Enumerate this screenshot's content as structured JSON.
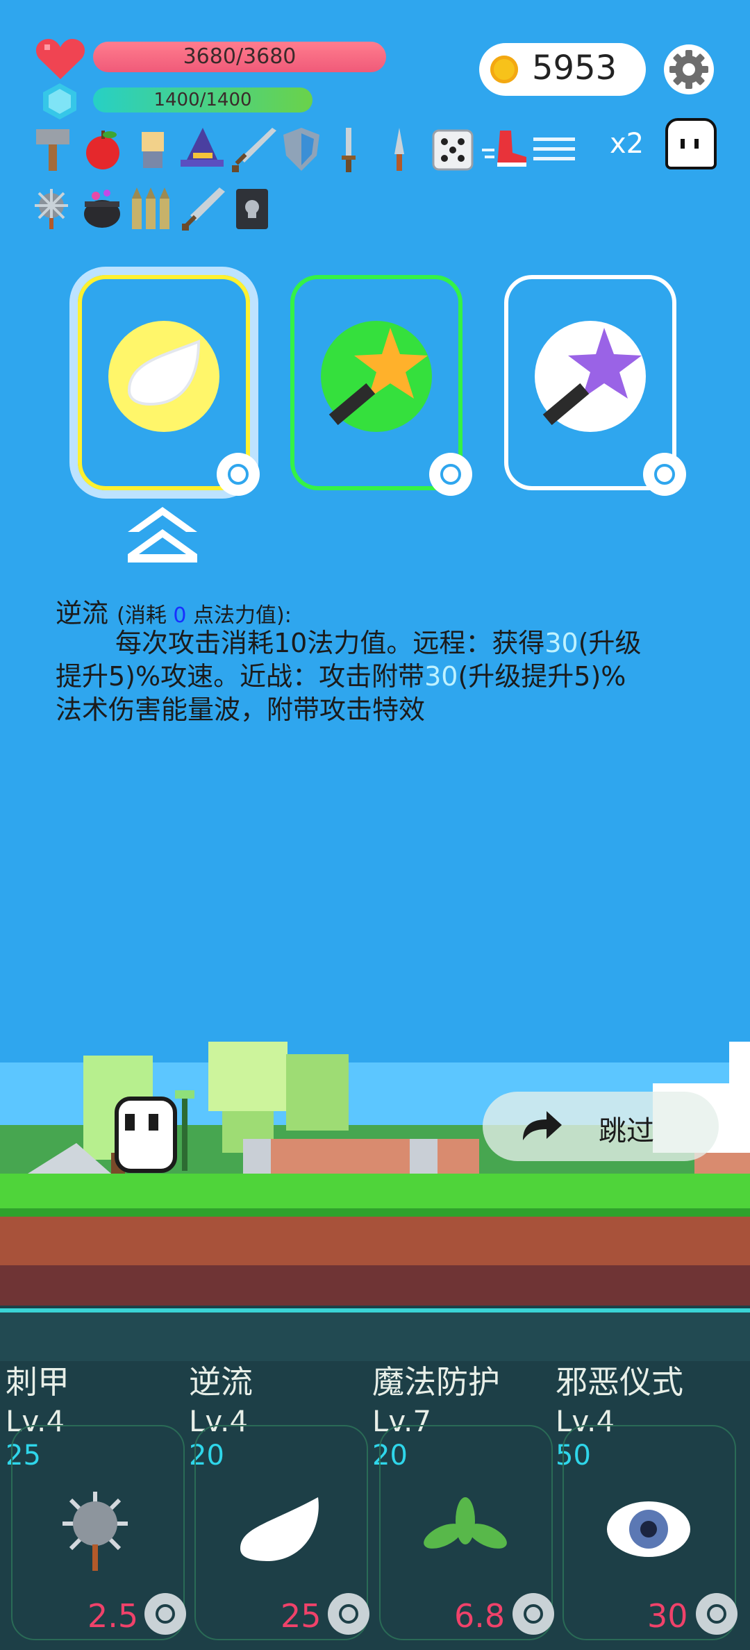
{
  "hud": {
    "hp_text": "3680/3680",
    "hp_fraction": 1.0,
    "mp_text": "1400/1400",
    "mp_fraction": 1.0,
    "coins": "5953",
    "multiplier": "x2",
    "icons": [
      "heart-icon",
      "mana-gem-icon",
      "coin-icon",
      "gear-icon",
      "ghost-icon"
    ]
  },
  "inventory": {
    "row1": [
      "hammer",
      "apple",
      "gauntlet",
      "wizard-hat",
      "sword",
      "shield",
      "dagger",
      "knife",
      "dice",
      "boot",
      "arrows"
    ],
    "row2": [
      "spiked-mace",
      "cauldron",
      "bullets",
      "broadsword",
      "skull-book"
    ]
  },
  "choices": [
    {
      "name": "wing-orb",
      "border": "#fff12f",
      "selected": true
    },
    {
      "name": "gold-star-wand",
      "border": "#35f246",
      "selected": false
    },
    {
      "name": "purple-star-wand",
      "border": "#ffffff",
      "selected": false
    }
  ],
  "description": {
    "title": "逆流",
    "cost_prefix": "(消耗 ",
    "cost_value": "0",
    "cost_suffix": " 点法力值):",
    "line1_a": "每次攻击消耗10法力值。远程：获得",
    "line1_v": "30",
    "line1_b": "(升级",
    "line2_a": "提升5)%攻速。近战：攻击附带",
    "line2_v": "30",
    "line2_b": "(升级提升5)%",
    "line3": "法术伤害能量波，附带攻击特效"
  },
  "skip_label": "跳过",
  "slots": [
    {
      "name": "刺甲",
      "level": "Lv.4",
      "cost": "25",
      "value": "2.5",
      "icon": "spiked-ball-icon"
    },
    {
      "name": "逆流",
      "level": "Lv.4",
      "cost": "20",
      "value": "25",
      "icon": "wing-icon"
    },
    {
      "name": "魔法防护",
      "level": "Lv.7",
      "cost": "20",
      "value": "6.8",
      "icon": "leaf-icon"
    },
    {
      "name": "邪恶仪式",
      "level": "Lv.4",
      "cost": "50",
      "value": "30",
      "icon": "eye-icon"
    }
  ]
}
